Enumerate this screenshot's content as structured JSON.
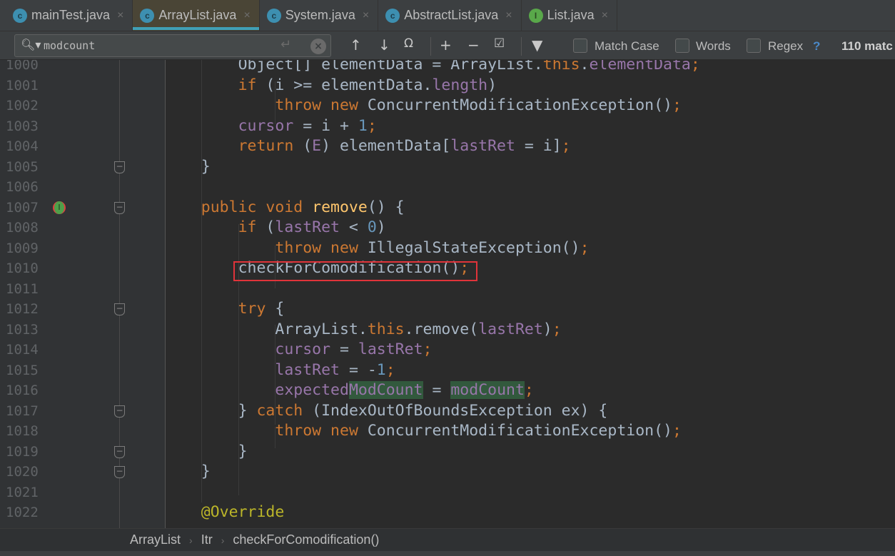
{
  "tabs": [
    {
      "label": "mainTest.java",
      "icon": "class-icon",
      "active": false
    },
    {
      "label": "ArrayList.java",
      "icon": "class-icon",
      "active": true
    },
    {
      "label": "System.java",
      "icon": "class-icon",
      "active": false
    },
    {
      "label": "AbstractList.java",
      "icon": "class-icon",
      "active": false
    },
    {
      "label": "List.java",
      "icon": "interface-icon",
      "active": false
    }
  ],
  "search": {
    "query": "modcount",
    "match_case_label": "Match Case",
    "words_label": "Words",
    "regex_label": "Regex",
    "help_label": "?",
    "match_count": "110 matc",
    "match_case_checked": false,
    "words_checked": false,
    "regex_checked": false
  },
  "editor": {
    "lines": [
      {
        "n": "1000",
        "indent": 2,
        "tokens": [
          [
            "",
            "Object[] elementData = ArrayList."
          ],
          [
            "kw",
            "this"
          ],
          [
            "",
            "."
          ],
          [
            "fld",
            "elementData"
          ],
          [
            "kw",
            ";"
          ]
        ]
      },
      {
        "n": "1001",
        "indent": 2,
        "tokens": [
          [
            "kw",
            "if"
          ],
          [
            "",
            " (i >= elementData."
          ],
          [
            "fld",
            "length"
          ],
          [
            "",
            ")"
          ]
        ]
      },
      {
        "n": "1002",
        "indent": 3,
        "tokens": [
          [
            "kw",
            "throw new"
          ],
          [
            "",
            " ConcurrentModificationException()"
          ],
          [
            "kw",
            ";"
          ]
        ]
      },
      {
        "n": "1003",
        "indent": 2,
        "tokens": [
          [
            "fld",
            "cursor"
          ],
          [
            "",
            " = i + "
          ],
          [
            "num",
            "1"
          ],
          [
            "kw",
            ";"
          ]
        ]
      },
      {
        "n": "1004",
        "indent": 2,
        "tokens": [
          [
            "kw",
            "return"
          ],
          [
            "",
            " ("
          ],
          [
            "fld",
            "E"
          ],
          [
            "",
            ") elementData["
          ],
          [
            "fld",
            "lastRet"
          ],
          [
            "",
            " = i]"
          ],
          [
            "kw",
            ";"
          ]
        ]
      },
      {
        "n": "1005",
        "indent": 1,
        "tokens": [
          [
            "",
            "}"
          ]
        ],
        "fold": true
      },
      {
        "n": "1006",
        "indent": 0,
        "tokens": []
      },
      {
        "n": "1007",
        "indent": 1,
        "tokens": [
          [
            "kw",
            "public void"
          ],
          [
            "",
            " "
          ],
          [
            "mdecl",
            "remove"
          ],
          [
            "",
            "() {"
          ]
        ],
        "fold": true,
        "marker": true
      },
      {
        "n": "1008",
        "indent": 2,
        "tokens": [
          [
            "kw",
            "if"
          ],
          [
            "",
            " ("
          ],
          [
            "fld",
            "lastRet"
          ],
          [
            "",
            " < "
          ],
          [
            "num",
            "0"
          ],
          [
            "",
            ")"
          ]
        ]
      },
      {
        "n": "1009",
        "indent": 3,
        "tokens": [
          [
            "kw",
            "throw new"
          ],
          [
            "",
            " IllegalStateException()"
          ],
          [
            "kw",
            ";"
          ]
        ]
      },
      {
        "n": "1010",
        "indent": 2,
        "tokens": [
          [
            "",
            "checkForComodification()"
          ],
          [
            "kw",
            ";"
          ]
        ]
      },
      {
        "n": "1011",
        "indent": 0,
        "tokens": []
      },
      {
        "n": "1012",
        "indent": 2,
        "tokens": [
          [
            "kw",
            "try"
          ],
          [
            "",
            " {"
          ]
        ],
        "fold": true
      },
      {
        "n": "1013",
        "indent": 3,
        "tokens": [
          [
            "",
            "ArrayList."
          ],
          [
            "kw",
            "this"
          ],
          [
            "",
            ".remove("
          ],
          [
            "fld",
            "lastRet"
          ],
          [
            "",
            ")"
          ],
          [
            "kw",
            ";"
          ]
        ]
      },
      {
        "n": "1014",
        "indent": 3,
        "tokens": [
          [
            "fld",
            "cursor"
          ],
          [
            "",
            " = "
          ],
          [
            "fld",
            "lastRet"
          ],
          [
            "kw",
            ";"
          ]
        ]
      },
      {
        "n": "1015",
        "indent": 3,
        "tokens": [
          [
            "fld",
            "lastRet"
          ],
          [
            "",
            " = -"
          ],
          [
            "num",
            "1"
          ],
          [
            "kw",
            ";"
          ]
        ]
      },
      {
        "n": "1016",
        "indent": 3,
        "tokens": [
          [
            "fld",
            "expected"
          ],
          [
            "fld hl",
            "ModCount"
          ],
          [
            "",
            " = "
          ],
          [
            "fld hl",
            "modCount"
          ],
          [
            "kw",
            ";"
          ]
        ]
      },
      {
        "n": "1017",
        "indent": 2,
        "tokens": [
          [
            "",
            "} "
          ],
          [
            "kw",
            "catch"
          ],
          [
            "",
            " (IndexOutOfBoundsException ex) {"
          ]
        ],
        "fold": true
      },
      {
        "n": "1018",
        "indent": 3,
        "tokens": [
          [
            "kw",
            "throw new"
          ],
          [
            "",
            " ConcurrentModificationException()"
          ],
          [
            "kw",
            ";"
          ]
        ]
      },
      {
        "n": "1019",
        "indent": 2,
        "tokens": [
          [
            "",
            "}"
          ]
        ],
        "fold": true
      },
      {
        "n": "1020",
        "indent": 1,
        "tokens": [
          [
            "",
            "}"
          ]
        ],
        "fold": true
      },
      {
        "n": "1021",
        "indent": 0,
        "tokens": []
      },
      {
        "n": "1022",
        "indent": 1,
        "tokens": [
          [
            "ann",
            "@Override"
          ]
        ]
      }
    ]
  },
  "breadcrumb": [
    "ArrayList",
    "Itr",
    "checkForComodification()"
  ],
  "colors": {
    "keyword": "#cc7832",
    "field": "#9876aa",
    "number": "#6897bb",
    "method": "#ffc66d",
    "annotation": "#bbb529",
    "highlight_box": "#e0333a",
    "search_match": "#32593d"
  }
}
